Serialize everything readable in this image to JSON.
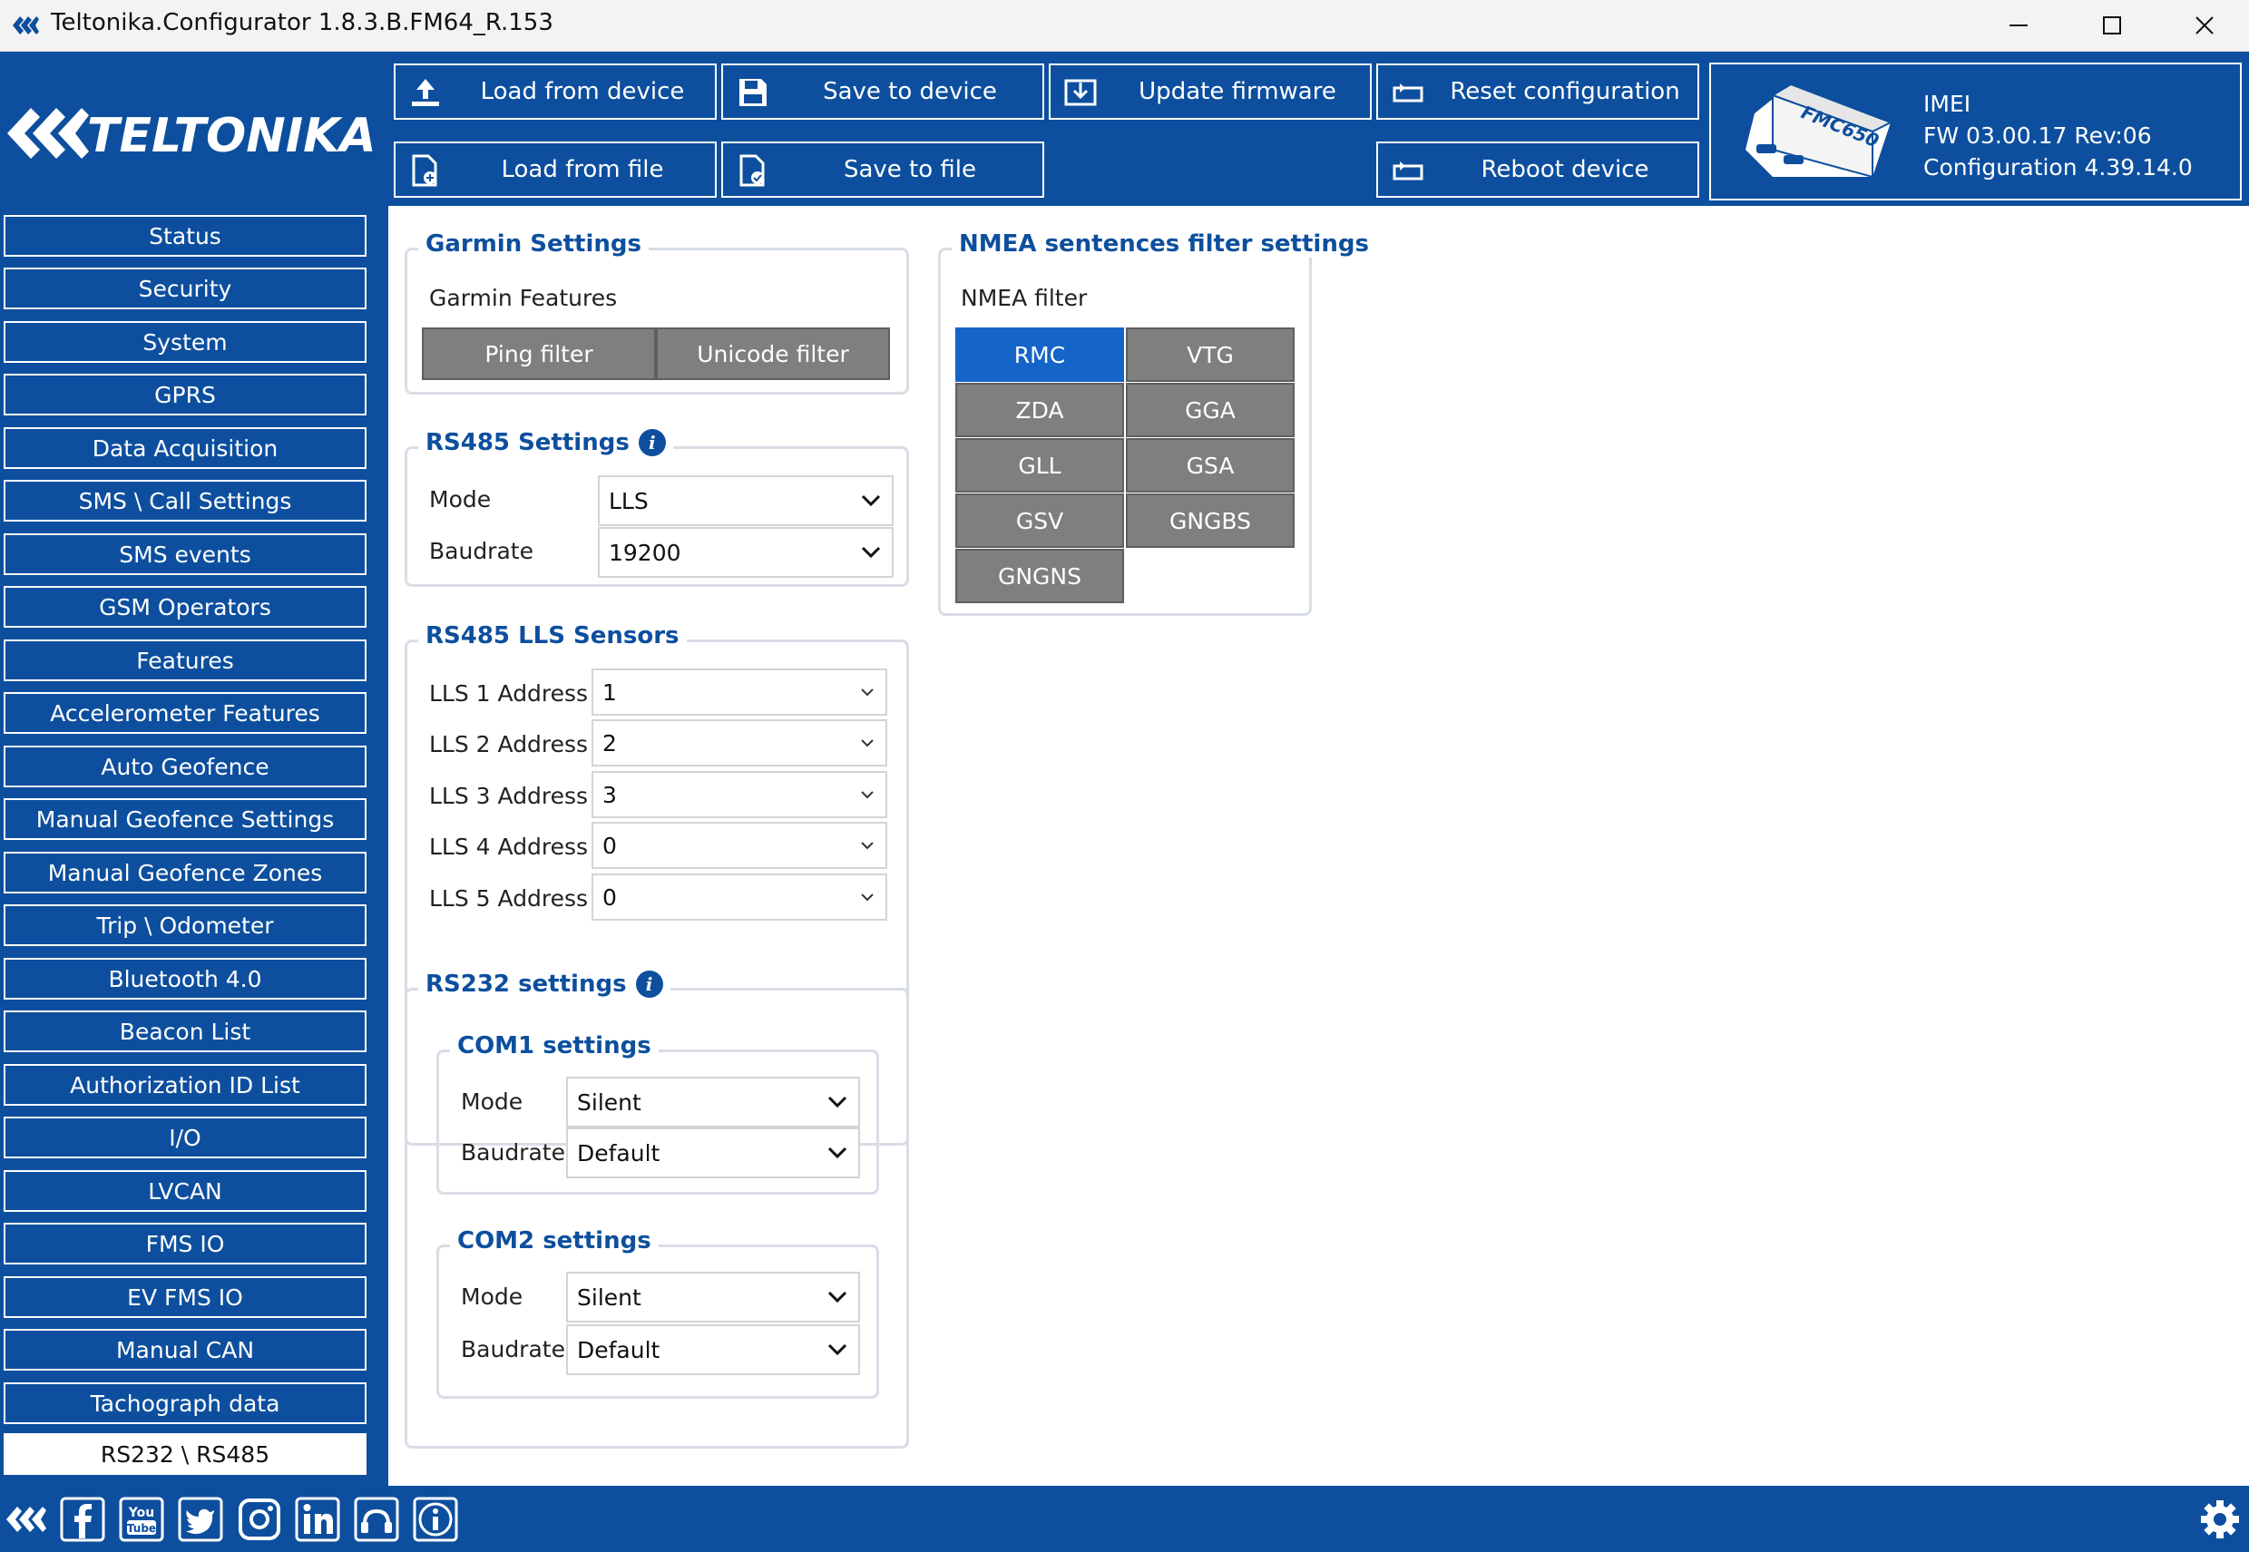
{
  "window": {
    "title": "Teltonika.Configurator 1.8.3.B.FM64_R.153"
  },
  "header": {
    "buttons": {
      "load_device": "Load from device",
      "save_device": "Save to device",
      "update_fw": "Update firmware",
      "reset_config": "Reset configuration",
      "load_file": "Load from file",
      "save_file": "Save to file",
      "reboot": "Reboot device"
    },
    "device": {
      "model": "FMC650",
      "imei_label": "IMEI",
      "fw": "FW  03.00.17 Rev:06",
      "configuration": "Configuration  4.39.14.0"
    }
  },
  "sidebar": {
    "items": [
      "Status",
      "Security",
      "System",
      "GPRS",
      "Data Acquisition",
      "SMS \\ Call Settings",
      "SMS events",
      "GSM Operators",
      "Features",
      "Accelerometer Features",
      "Auto Geofence",
      "Manual Geofence Settings",
      "Manual Geofence Zones",
      "Trip \\ Odometer",
      "Bluetooth 4.0",
      "Beacon List",
      "Authorization ID List",
      "I/O",
      "LVCAN",
      "FMS IO",
      "EV FMS IO",
      "Manual CAN",
      "Tachograph data",
      "RS232 \\ RS485"
    ],
    "active": "RS232 \\ RS485"
  },
  "garmin": {
    "title": "Garmin Settings",
    "features_label": "Garmin Features",
    "ping_filter": "Ping filter",
    "unicode_filter": "Unicode filter"
  },
  "rs485": {
    "title": "RS485 Settings",
    "mode_label": "Mode",
    "mode_value": "LLS",
    "baudrate_label": "Baudrate",
    "baudrate_value": "19200"
  },
  "lls": {
    "title": "RS485 LLS Sensors",
    "rows": [
      {
        "label": "LLS 1 Address",
        "value": "1"
      },
      {
        "label": "LLS 2 Address",
        "value": "2"
      },
      {
        "label": "LLS 3 Address",
        "value": "3"
      },
      {
        "label": "LLS 4 Address",
        "value": "0"
      },
      {
        "label": "LLS 5 Address",
        "value": "0"
      }
    ]
  },
  "rs232": {
    "title": "RS232 settings",
    "com1": {
      "title": "COM1 settings",
      "mode_label": "Mode",
      "mode_value": "Silent",
      "baudrate_label": "Baudrate",
      "baudrate_value": "Default"
    },
    "com2": {
      "title": "COM2 settings",
      "mode_label": "Mode",
      "mode_value": "Silent",
      "baudrate_label": "Baudrate",
      "baudrate_value": "Default"
    }
  },
  "nmea": {
    "title": "NMEA sentences filter settings",
    "filter_label": "NMEA filter",
    "buttons": [
      "RMC",
      "VTG",
      "ZDA",
      "GGA",
      "GLL",
      "GSA",
      "GSV",
      "GNGBS",
      "GNGNS"
    ],
    "active": "RMC"
  },
  "colors": {
    "brand_blue": "#0d4f9e",
    "active_blue": "#1565c9",
    "button_gray": "#7f7f7f"
  },
  "footer_icons": [
    "teltonika-icon",
    "facebook-icon",
    "youtube-icon",
    "twitter-icon",
    "instagram-icon",
    "linkedin-icon",
    "community-icon",
    "info-icon",
    "settings-gear-icon"
  ]
}
